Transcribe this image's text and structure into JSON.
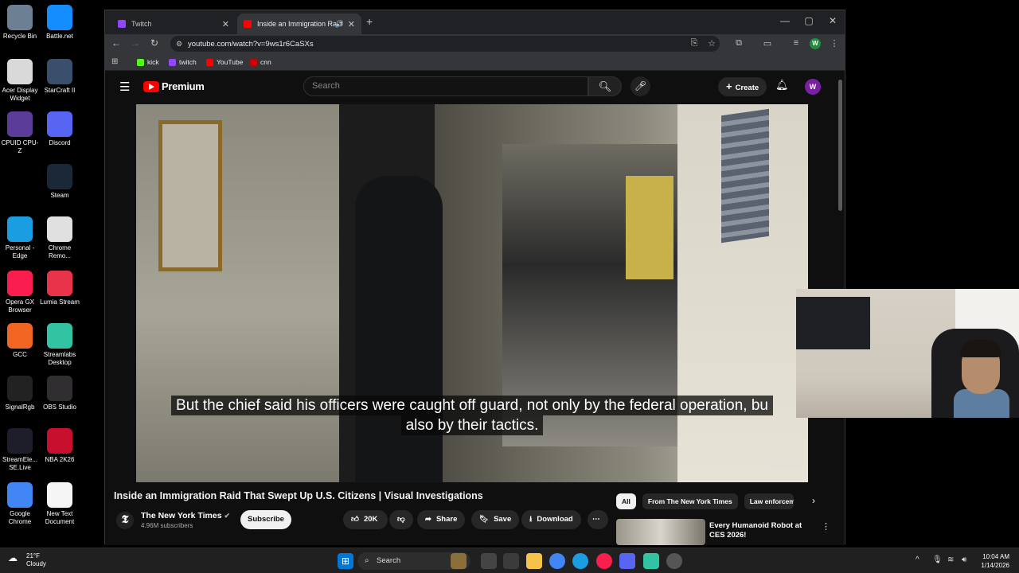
{
  "desktop": {
    "icons": [
      {
        "label": "Recycle Bin",
        "icon": "recycle-bin-icon",
        "color": "#6d7f93"
      },
      {
        "label": "Battle.net",
        "icon": "battlenet-icon",
        "color": "#148eff"
      },
      {
        "label": "Acer Display Widget",
        "icon": "acer-display-icon",
        "color": "#d9d9d9"
      },
      {
        "label": "StarCraft II",
        "icon": "starcraft-icon",
        "color": "#3a4f6b"
      },
      {
        "label": "CPUID CPU-Z",
        "icon": "cpuz-icon",
        "color": "#5b3d99"
      },
      {
        "label": "Discord",
        "icon": "discord-icon",
        "color": "#5865f2"
      },
      {
        "label": "Steam",
        "icon": "steam-icon",
        "color": "#1b2838"
      },
      {
        "label": "Personal - Edge",
        "icon": "edge-icon",
        "color": "#1b9de2"
      },
      {
        "label": "Chrome Remo...",
        "icon": "chrome-remote-icon",
        "color": "#e0e0e0"
      },
      {
        "label": "Opera GX Browser",
        "icon": "opera-gx-icon",
        "color": "#fa1e4e"
      },
      {
        "label": "Lumia Stream",
        "icon": "lumia-icon",
        "color": "#e8334b"
      },
      {
        "label": "GCC",
        "icon": "gcc-icon",
        "color": "#f26522"
      },
      {
        "label": "Streamlabs Desktop",
        "icon": "streamlabs-icon",
        "color": "#31c3a2"
      },
      {
        "label": "SignalRgb",
        "icon": "signalrgb-icon",
        "color": "#222"
      },
      {
        "label": "OBS Studio",
        "icon": "obs-icon",
        "color": "#302e31"
      },
      {
        "label": "StreamEle... SE.Live",
        "icon": "streamelements-icon",
        "color": "#1d1e2a"
      },
      {
        "label": "NBA 2K26",
        "icon": "nba2k-icon",
        "color": "#c8102e"
      },
      {
        "label": "Google Chrome",
        "icon": "chrome-icon",
        "color": "#4285f4"
      },
      {
        "label": "New Text Document",
        "icon": "text-document-icon",
        "color": "#f5f5f5"
      }
    ]
  },
  "browser": {
    "tabs": [
      {
        "title": "Twitch",
        "favicon_color": "#9146ff"
      },
      {
        "title": "Inside an Immigration Raid",
        "favicon_color": "#ff0000"
      }
    ],
    "url": "youtube.com/watch?v=9ws1r6CaSXs",
    "bookmarks": [
      {
        "label": "kick",
        "color": "#53fc18"
      },
      {
        "label": "twitch",
        "color": "#9146ff"
      },
      {
        "label": "YouTube",
        "color": "#ff0000"
      },
      {
        "label": "cnn",
        "color": "#cc0000"
      }
    ],
    "profile_initial": "W"
  },
  "youtube": {
    "brand": "Premium",
    "search_placeholder": "Search",
    "create_label": "Create",
    "avatar_initial": "W",
    "caption_line1": "But the chief said his officers were caught off guard, not only by the federal operation, bu",
    "caption_line2": "also by their tactics.",
    "watermark": "SUBSCRIBE",
    "video_title": "Inside an Immigration Raid That Swept Up U.S. Citizens | Visual Investigations",
    "channel_name": "The New York Times",
    "subscribers": "4.96M subscribers",
    "subscribe_label": "Subscribe",
    "likes": "20K",
    "share_label": "Share",
    "save_label": "Save",
    "download_label": "Download",
    "chips": [
      "All",
      "From The New York Times",
      "Law enforcem"
    ],
    "rec_title": "Every Humanoid Robot at CES 2026!"
  },
  "taskbar": {
    "temp": "21°F",
    "condition": "Cloudy",
    "search_label": "Search",
    "time": "10:04 AM",
    "date": "1/14/2026"
  }
}
